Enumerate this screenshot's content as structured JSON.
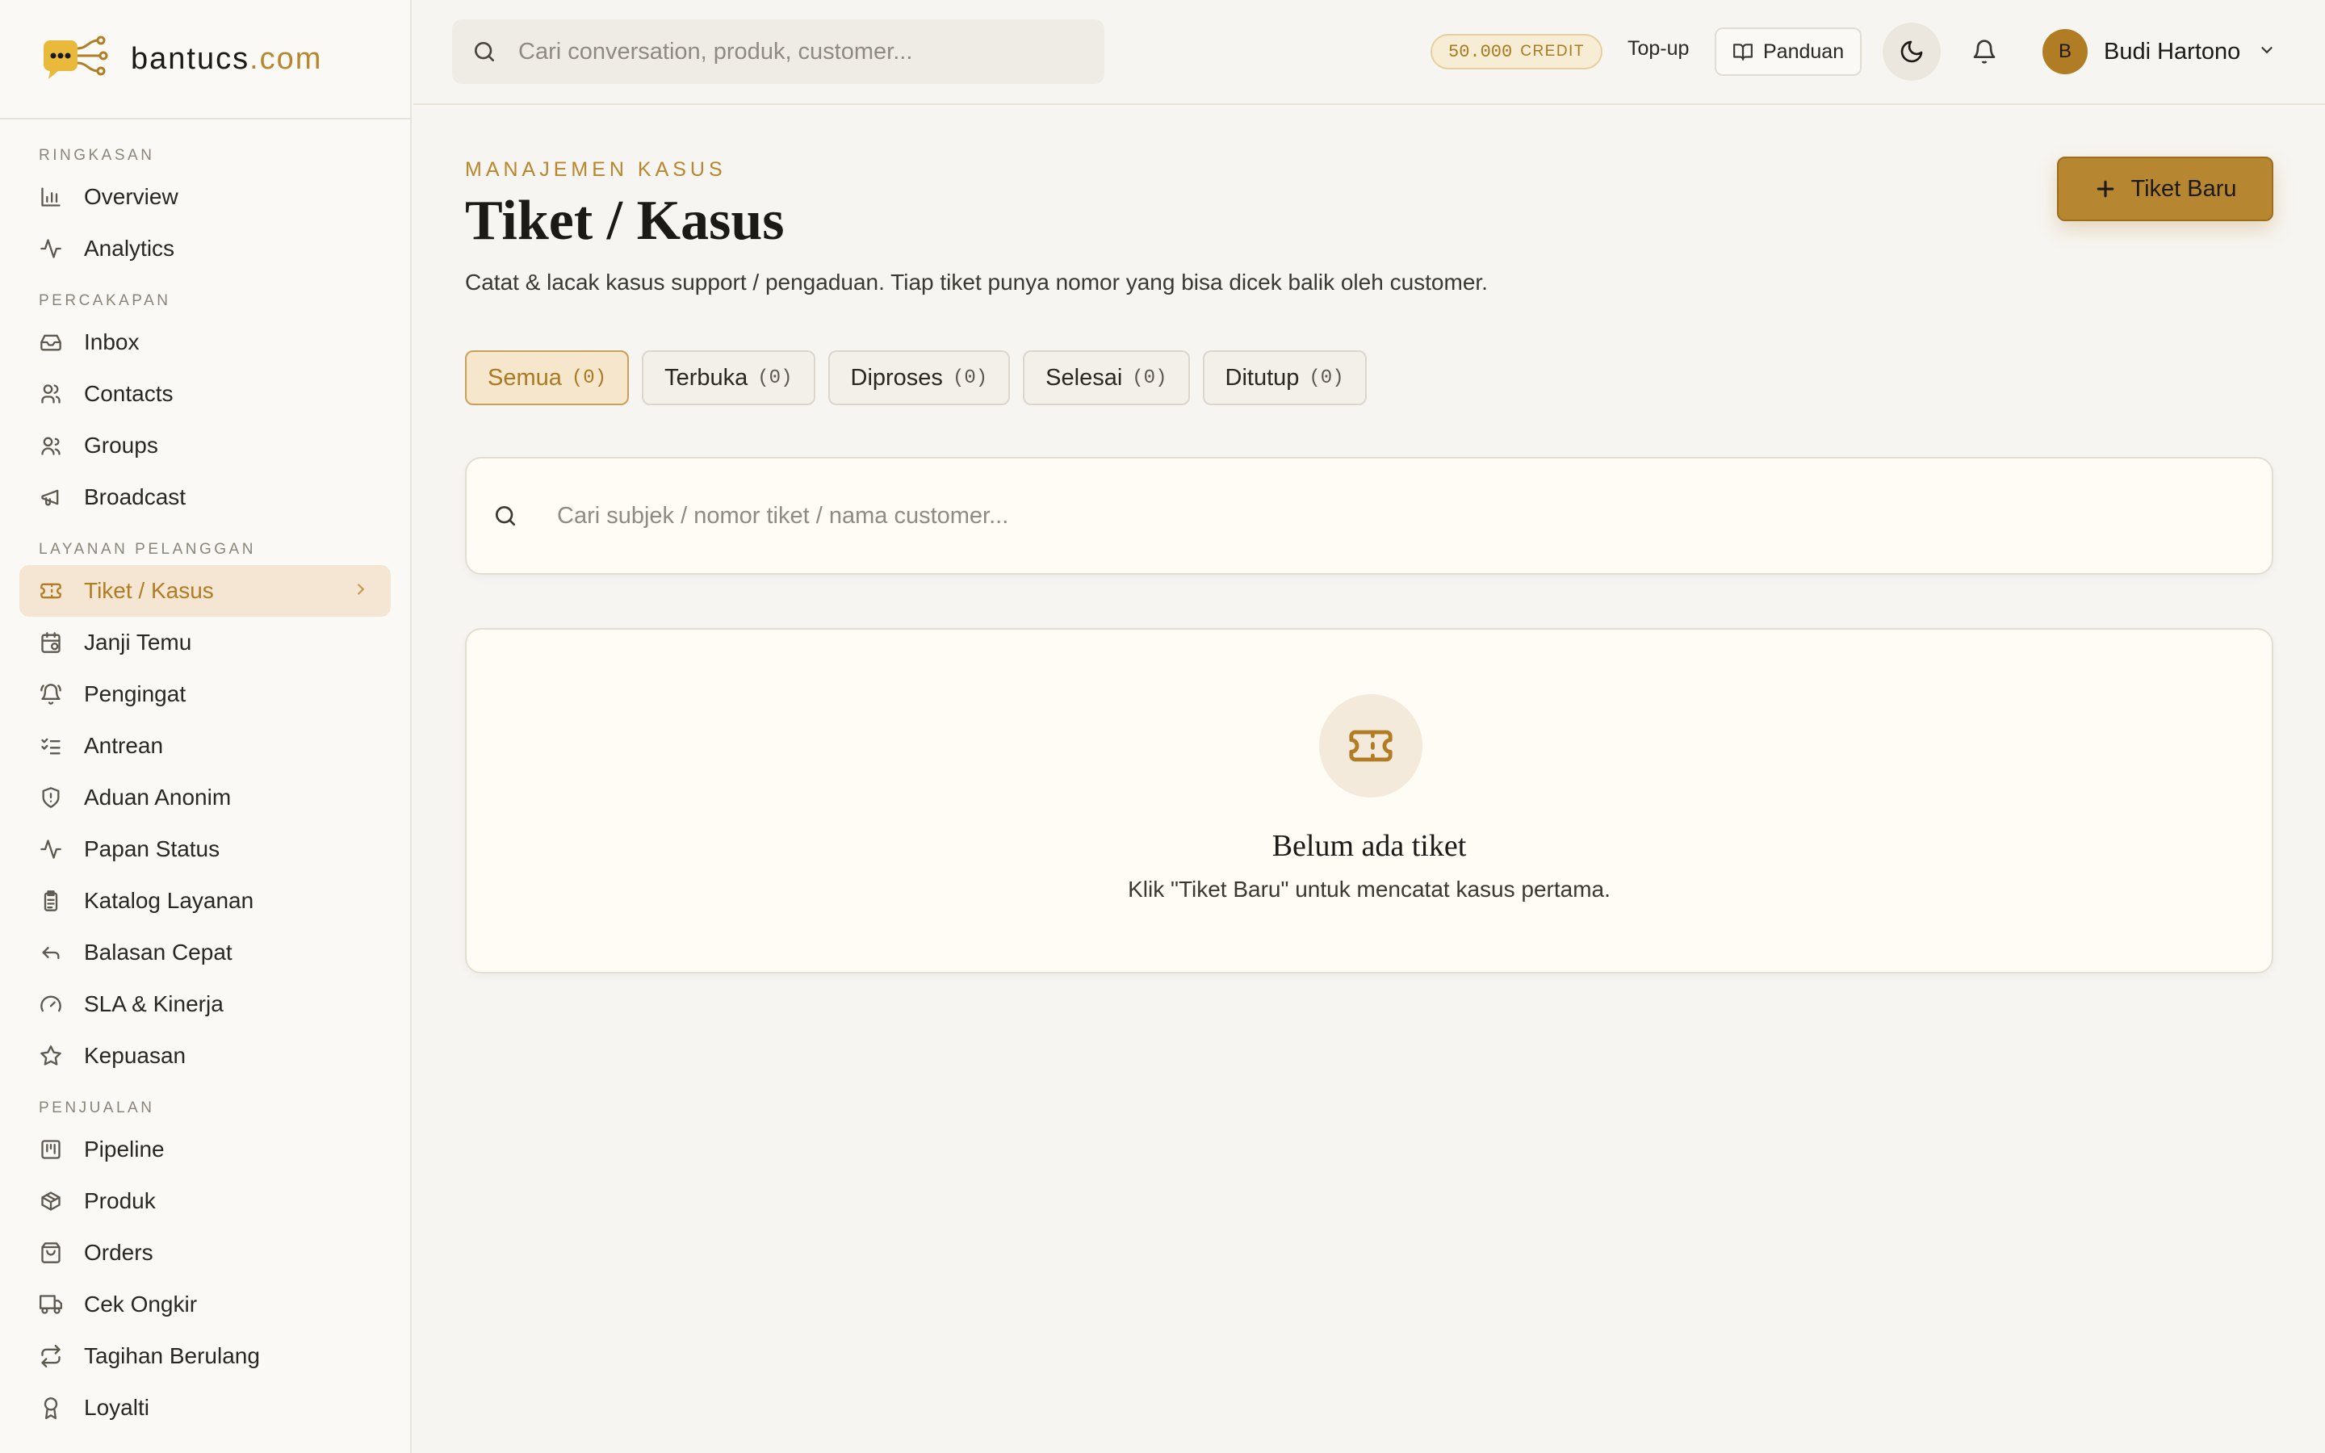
{
  "brand": {
    "name": "bantucs",
    "tld": ".com"
  },
  "sidebar": {
    "sections": [
      {
        "label": "RINGKASAN",
        "items": [
          {
            "label": "Overview",
            "icon": "bar-chart-icon"
          },
          {
            "label": "Analytics",
            "icon": "activity-icon"
          }
        ]
      },
      {
        "label": "PERCAKAPAN",
        "items": [
          {
            "label": "Inbox",
            "icon": "inbox-icon"
          },
          {
            "label": "Contacts",
            "icon": "users-icon"
          },
          {
            "label": "Groups",
            "icon": "group-icon"
          },
          {
            "label": "Broadcast",
            "icon": "megaphone-icon"
          }
        ]
      },
      {
        "label": "LAYANAN PELANGGAN",
        "items": [
          {
            "label": "Tiket / Kasus",
            "icon": "ticket-icon",
            "active": true
          },
          {
            "label": "Janji Temu",
            "icon": "calendar-clock-icon"
          },
          {
            "label": "Pengingat",
            "icon": "bell-ring-icon"
          },
          {
            "label": "Antrean",
            "icon": "list-checks-icon"
          },
          {
            "label": "Aduan Anonim",
            "icon": "shield-icon"
          },
          {
            "label": "Papan Status",
            "icon": "activity-icon"
          },
          {
            "label": "Katalog Layanan",
            "icon": "clipboard-icon"
          },
          {
            "label": "Balasan Cepat",
            "icon": "reply-icon"
          },
          {
            "label": "SLA & Kinerja",
            "icon": "gauge-icon"
          },
          {
            "label": "Kepuasan",
            "icon": "star-icon"
          }
        ]
      },
      {
        "label": "PENJUALAN",
        "items": [
          {
            "label": "Pipeline",
            "icon": "kanban-icon"
          },
          {
            "label": "Produk",
            "icon": "package-icon"
          },
          {
            "label": "Orders",
            "icon": "shopping-bag-icon"
          },
          {
            "label": "Cek Ongkir",
            "icon": "truck-icon"
          },
          {
            "label": "Tagihan Berulang",
            "icon": "repeat-icon"
          },
          {
            "label": "Loyalti",
            "icon": "award-icon"
          }
        ]
      }
    ]
  },
  "topbar": {
    "search_placeholder": "Cari conversation, produk, customer...",
    "credit_value": "50.000",
    "credit_unit": "CREDIT",
    "topup_label": "Top-up",
    "guide_label": "Panduan",
    "user_initial": "B",
    "user_name": "Budi Hartono"
  },
  "page": {
    "eyebrow": "MANAJEMEN KASUS",
    "title": "Tiket / Kasus",
    "description": "Catat & lacak kasus support / pengaduan. Tiap tiket punya nomor yang bisa dicek balik oleh customer.",
    "new_button": "Tiket Baru",
    "tabs": [
      {
        "label": "Semua",
        "count": "(0)",
        "active": true
      },
      {
        "label": "Terbuka",
        "count": "(0)"
      },
      {
        "label": "Diproses",
        "count": "(0)"
      },
      {
        "label": "Selesai",
        "count": "(0)"
      },
      {
        "label": "Ditutup",
        "count": "(0)"
      }
    ],
    "search_placeholder": "Cari subjek / nomor tiket / nama customer...",
    "empty_title": "Belum ada tiket",
    "empty_desc": "Klik \"Tiket Baru\" untuk mencatat kasus pertama."
  },
  "colors": {
    "accent": "#b07d24",
    "active_bg": "#f4e6d2",
    "background": "#f7f5f1"
  }
}
